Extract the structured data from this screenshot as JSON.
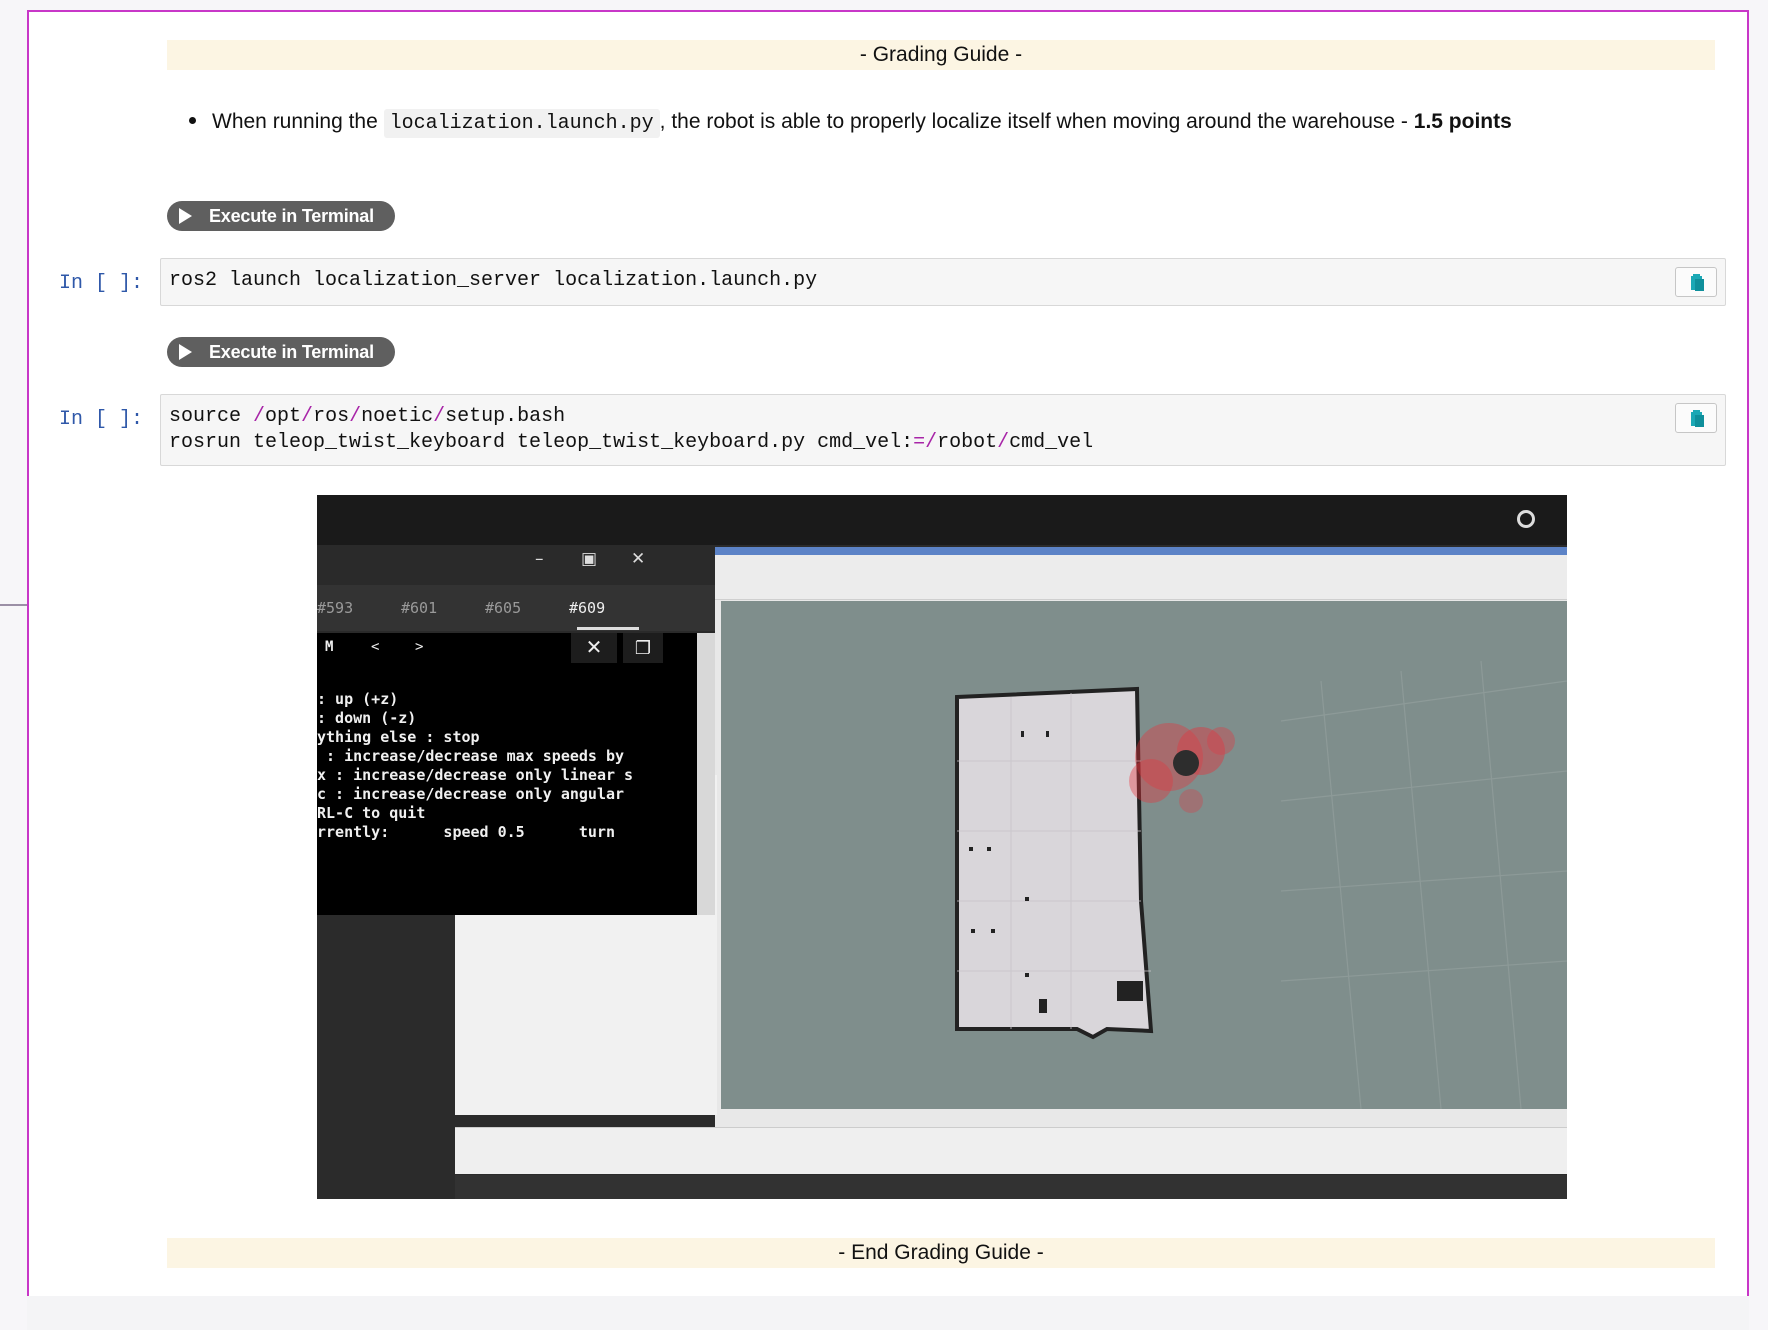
{
  "grading": {
    "start_label": "- Grading Guide -",
    "end_label": "- End Grading Guide -"
  },
  "bullet": {
    "prefix": "When running the",
    "code": "localization.launch.py",
    "middle": ", the robot is able to properly localize itself when moving around the warehouse -",
    "points": "1.5 points"
  },
  "execute_button_label": "Execute in Terminal",
  "cells": [
    {
      "prompt": "In [ ]:",
      "lines": [
        "ros2 launch localization_server localization.launch.py"
      ]
    },
    {
      "prompt": "In [ ]:",
      "line1": {
        "a": "source ",
        "op1": "/",
        "b": "opt",
        "op2": "/",
        "c": "ros",
        "op3": "/",
        "d": "noetic",
        "op4": "/",
        "e": "setup.bash"
      },
      "line2": {
        "a": "rosrun teleop_twist_keyboard teleop_twist_keyboard.py cmd_vel:",
        "op1": "=/",
        "b": "robot",
        "op2": "/",
        "c": "cmd_vel"
      }
    }
  ],
  "screenshot": {
    "tabs": [
      "#593",
      "#601",
      "#605",
      "#609"
    ],
    "active_tab": "#609",
    "terminal_lines": [
      ": up (+z)",
      ": down (-z)",
      "",
      "ything else : stop",
      "",
      " : increase/decrease max speeds by",
      "x : increase/decrease only linear s",
      "c : increase/decrease only angular",
      "",
      "RL-C to quit",
      "",
      "rrently:      speed 0.5      turn"
    ],
    "nav_glyphs": [
      "M",
      "<",
      ">"
    ],
    "colors": {
      "particles": "#e8323c",
      "map_bg": "#7f8e8c",
      "map_floor": "#d9d6da"
    }
  },
  "colors": {
    "frame_border": "#c837c8",
    "guide_bar": "#fcf5e3",
    "prompt": "#2f58a9",
    "operator": "#a825a8",
    "copy_icon": "#1ba8b5"
  }
}
